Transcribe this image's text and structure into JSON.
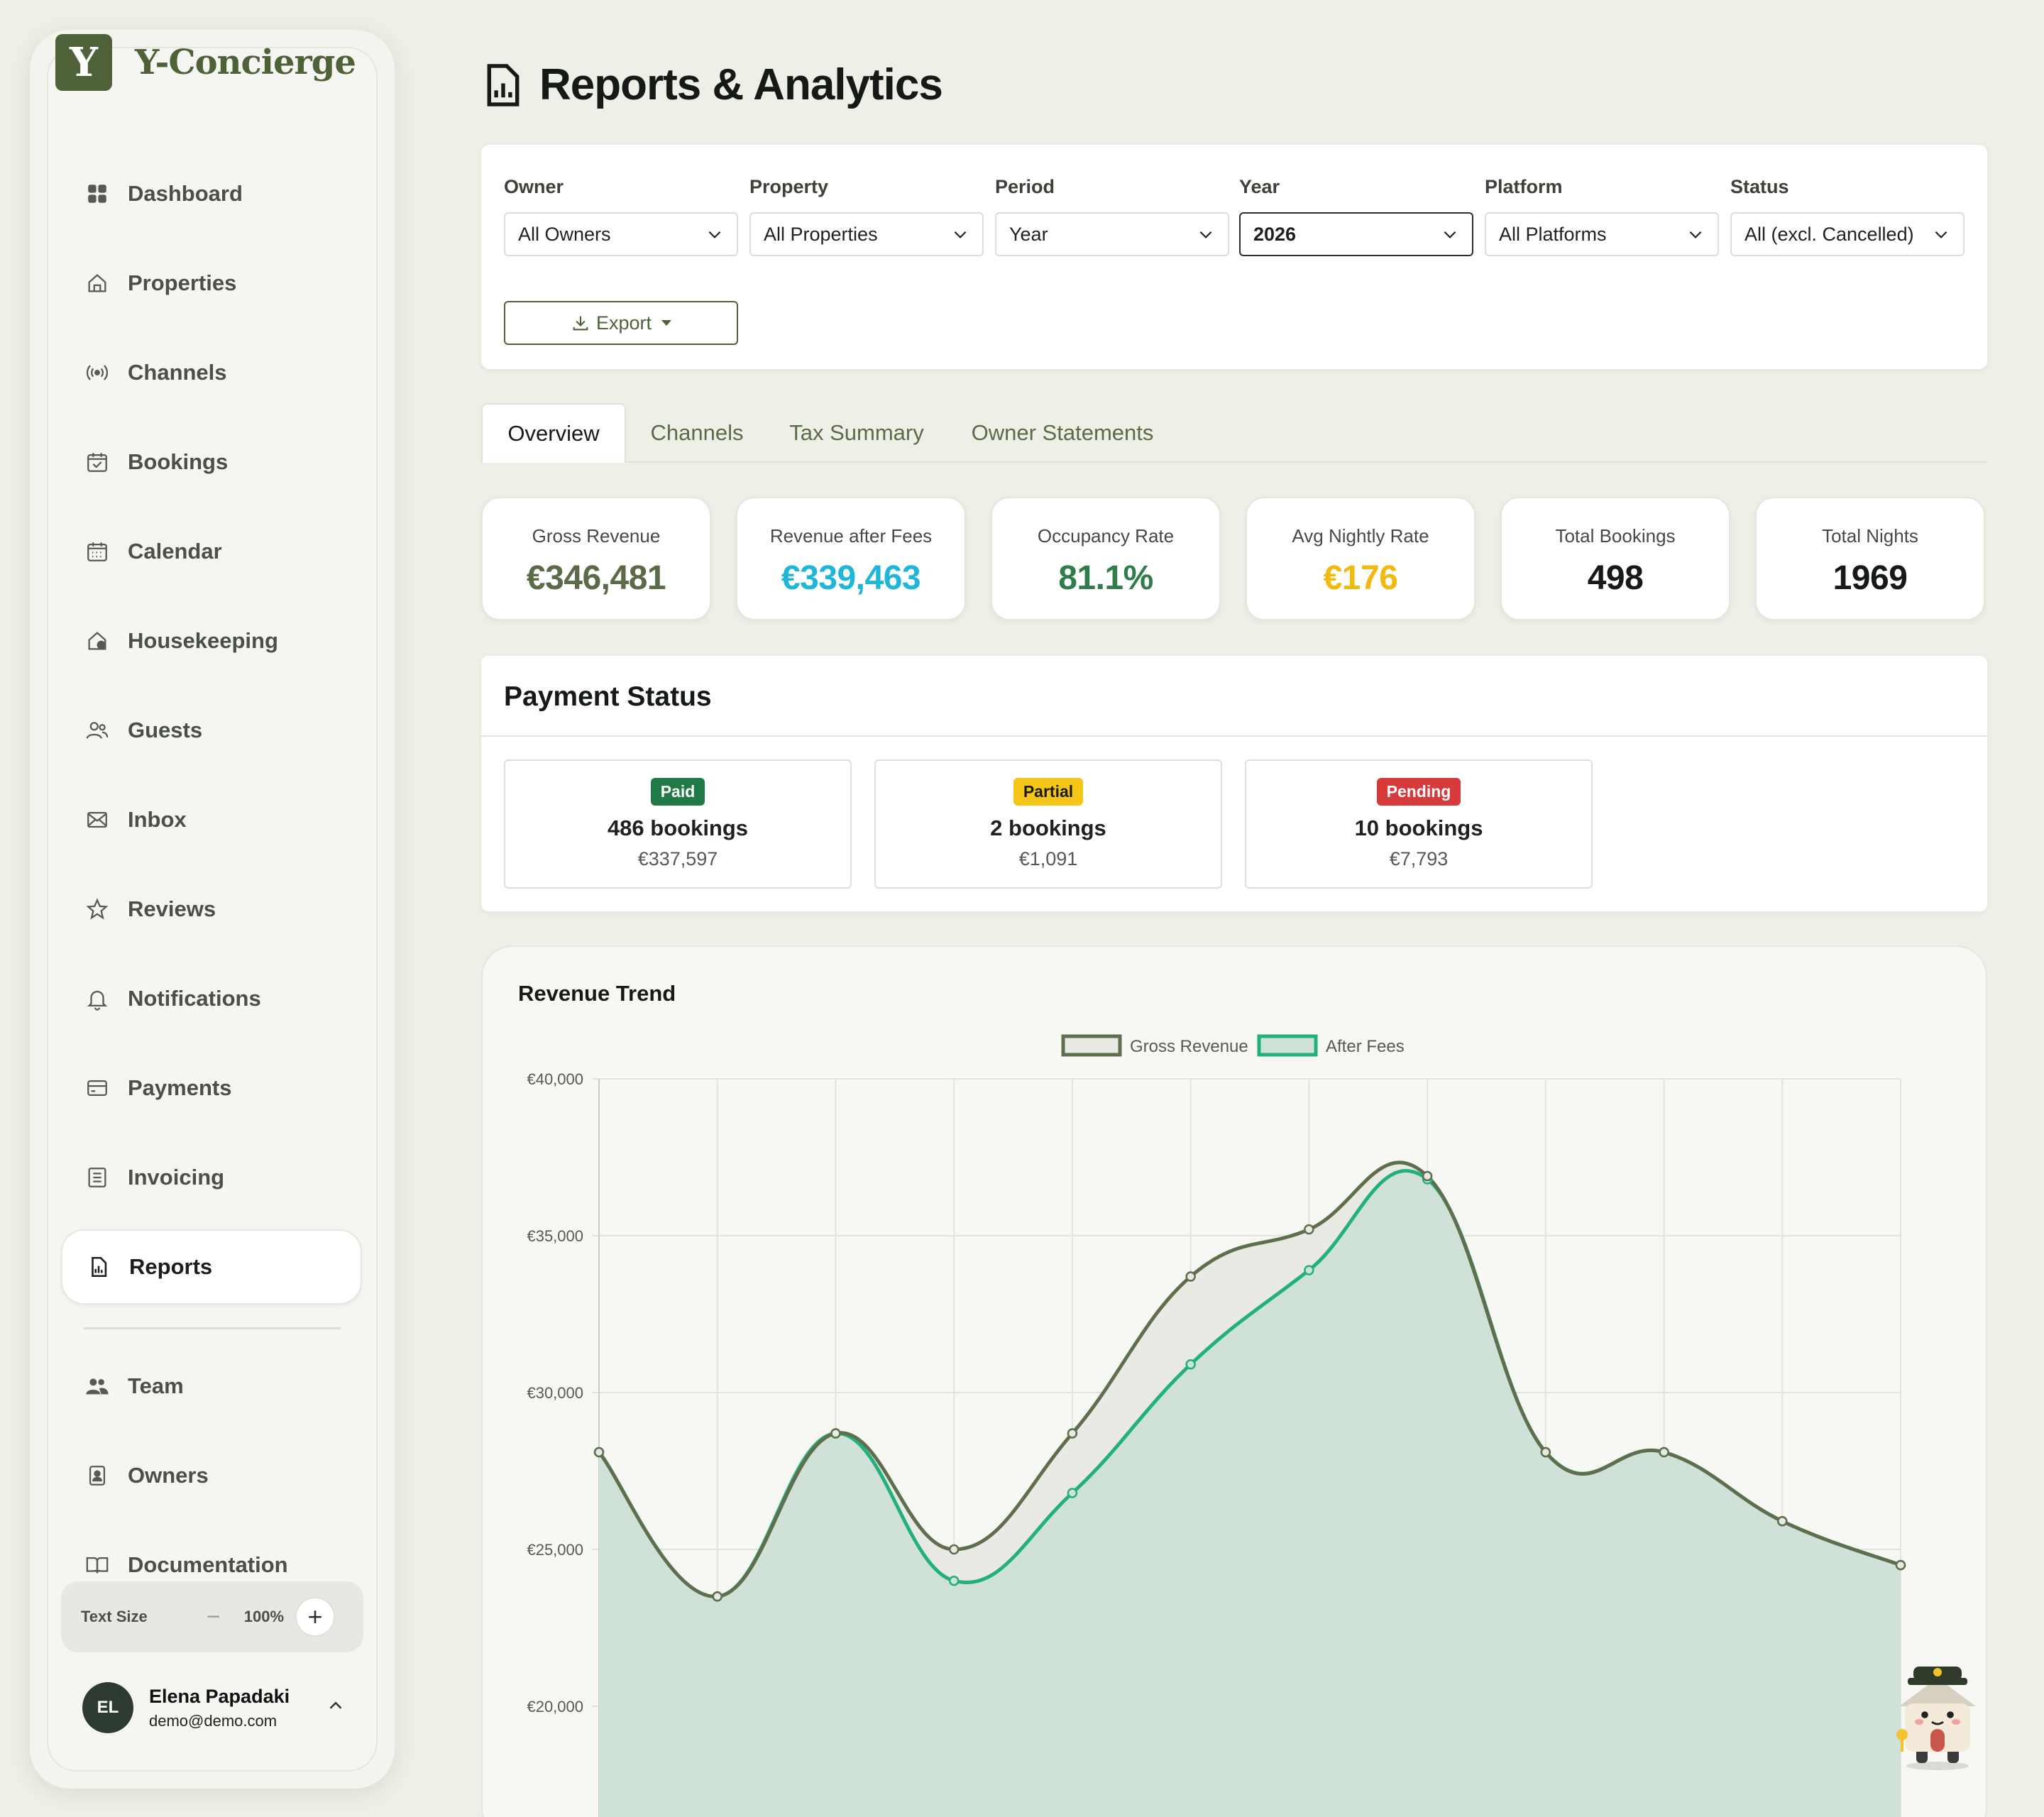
{
  "brand": {
    "logo_letter": "Y",
    "name": "Y-Concierge",
    "color": "#4f6139"
  },
  "sidebar": {
    "items": [
      {
        "label": "Dashboard",
        "icon": "dashboard-icon"
      },
      {
        "label": "Properties",
        "icon": "home-icon"
      },
      {
        "label": "Channels",
        "icon": "broadcast-icon"
      },
      {
        "label": "Bookings",
        "icon": "calendar-check-icon"
      },
      {
        "label": "Calendar",
        "icon": "calendar-grid-icon"
      },
      {
        "label": "Housekeeping",
        "icon": "house-clean-icon"
      },
      {
        "label": "Guests",
        "icon": "users-icon"
      },
      {
        "label": "Inbox",
        "icon": "mail-icon"
      },
      {
        "label": "Reviews",
        "icon": "star-icon"
      },
      {
        "label": "Notifications",
        "icon": "bell-icon"
      },
      {
        "label": "Payments",
        "icon": "credit-card-icon"
      },
      {
        "label": "Invoicing",
        "icon": "invoice-icon"
      },
      {
        "label": "Reports",
        "icon": "report-icon",
        "active": true
      }
    ],
    "secondary_items": [
      {
        "label": "Team",
        "icon": "team-icon"
      },
      {
        "label": "Owners",
        "icon": "owner-icon"
      },
      {
        "label": "Documentation",
        "icon": "book-icon"
      }
    ],
    "text_size": {
      "label": "Text Size",
      "value": "100%",
      "minus": "−",
      "plus": "+"
    },
    "user": {
      "initials": "EL",
      "name": "Elena Papadaki",
      "email": "demo@demo.com"
    }
  },
  "header": {
    "title": "Reports & Analytics"
  },
  "filters": [
    {
      "label": "Owner",
      "value": "All Owners"
    },
    {
      "label": "Property",
      "value": "All Properties"
    },
    {
      "label": "Period",
      "value": "Year"
    },
    {
      "label": "Year",
      "value": "2026",
      "focused": true
    },
    {
      "label": "Platform",
      "value": "All Platforms"
    },
    {
      "label": "Status",
      "value": "All (excl. Cancelled)"
    }
  ],
  "export_label": "Export",
  "tabs": [
    {
      "label": "Overview",
      "active": true
    },
    {
      "label": "Channels"
    },
    {
      "label": "Tax Summary"
    },
    {
      "label": "Owner Statements"
    }
  ],
  "kpis": [
    {
      "label": "Gross Revenue",
      "value": "€346,481",
      "color": "#5b6b48"
    },
    {
      "label": "Revenue after Fees",
      "value": "€339,463",
      "color": "#1eb6d9"
    },
    {
      "label": "Occupancy Rate",
      "value": "81.1%",
      "color": "#2f7d4a"
    },
    {
      "label": "Avg Nightly Rate",
      "value": "€176",
      "color": "#f2b90f"
    },
    {
      "label": "Total Bookings",
      "value": "498",
      "color": "#161a16"
    },
    {
      "label": "Total Nights",
      "value": "1969",
      "color": "#161a16"
    }
  ],
  "payment_status": {
    "title": "Payment Status",
    "items": [
      {
        "badge": "Paid",
        "badge_bg": "#1f7a45",
        "badge_fg": "#ffffff",
        "count": "486 bookings",
        "amount": "€337,597"
      },
      {
        "badge": "Partial",
        "badge_bg": "#f5c518",
        "badge_fg": "#1a1a1a",
        "count": "2 bookings",
        "amount": "€1,091"
      },
      {
        "badge": "Pending",
        "badge_bg": "#d63a3a",
        "badge_fg": "#ffffff",
        "count": "10 bookings",
        "amount": "€7,793"
      }
    ]
  },
  "chart_data": {
    "type": "area",
    "title": "Revenue Trend",
    "legend_position": "top-center",
    "grid": true,
    "y_tick_labels": [
      "€40,000",
      "€35,000",
      "€30,000",
      "€25,000",
      "€20,000"
    ],
    "y_ticks": [
      40000,
      35000,
      30000,
      25000,
      20000
    ],
    "ylim_visible": [
      20000,
      40000
    ],
    "series": [
      {
        "name": "Gross Revenue",
        "color": "#5f6e4d",
        "fill": "#e8e9e3",
        "values": [
          28100,
          23500,
          28700,
          25000,
          28700,
          33700,
          35200,
          36900,
          28100,
          28100,
          25900,
          24500
        ]
      },
      {
        "name": "After Fees",
        "color": "#22b07d",
        "fill": "#cfe2d7",
        "values": [
          28100,
          23500,
          28700,
          24000,
          26800,
          30900,
          33900,
          36800,
          28100,
          28100,
          25900,
          24500
        ]
      }
    ]
  }
}
